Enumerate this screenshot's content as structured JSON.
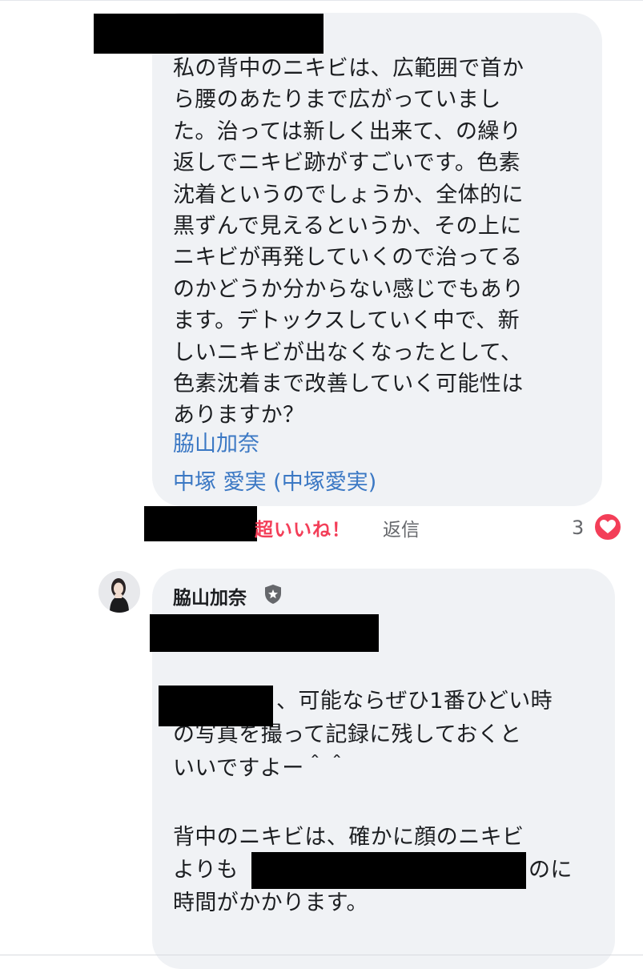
{
  "comment1": {
    "lines": [
      "私の背中のニキビは、広範囲で首か",
      "ら腰のあたりまで広がっていまし",
      "た。治っては新しく出来て、の繰り",
      "返しでニキビ跡がすごいです。色素",
      "沈着というのでしょうか、全体的に",
      "黒ずんで見えるというか、その上に",
      "ニキビが再発していくので治ってる",
      "のかどうか分からない感じでもあり",
      "ます。デトックスしていく中で、新",
      "しいニキビが出なくなったとして、",
      "色素沈着まで改善していく可能性は",
      "ありますか？"
    ],
    "mentions": [
      "脇山加奈",
      "中塚 愛実 (中塚愛実)"
    ],
    "reaction_label": "超いいね！",
    "reply_label": "返信",
    "reaction_count": "3",
    "reaction_icon": "heart-icon",
    "reaction_color": "#f33e58"
  },
  "comment2": {
    "author": "脇山加奈",
    "author_badge_icon": "shield-badge-icon",
    "paragraph1": {
      "line1": "、可能ならぜひ1番ひどい時",
      "line2": "の写真を撮って記録に残しておくと",
      "line3": "いいですよー＾＾"
    },
    "paragraph2": {
      "line1": "背中のニキビは、確かに顔のニキビ",
      "line2_start": "よりも",
      "line2_end": "のに",
      "line3": "時間がかかります。"
    }
  },
  "colors": {
    "bubble": "#f0f2f5",
    "mention": "#3b78c4",
    "secondary_text": "#65676b",
    "text": "#1c1e21"
  }
}
